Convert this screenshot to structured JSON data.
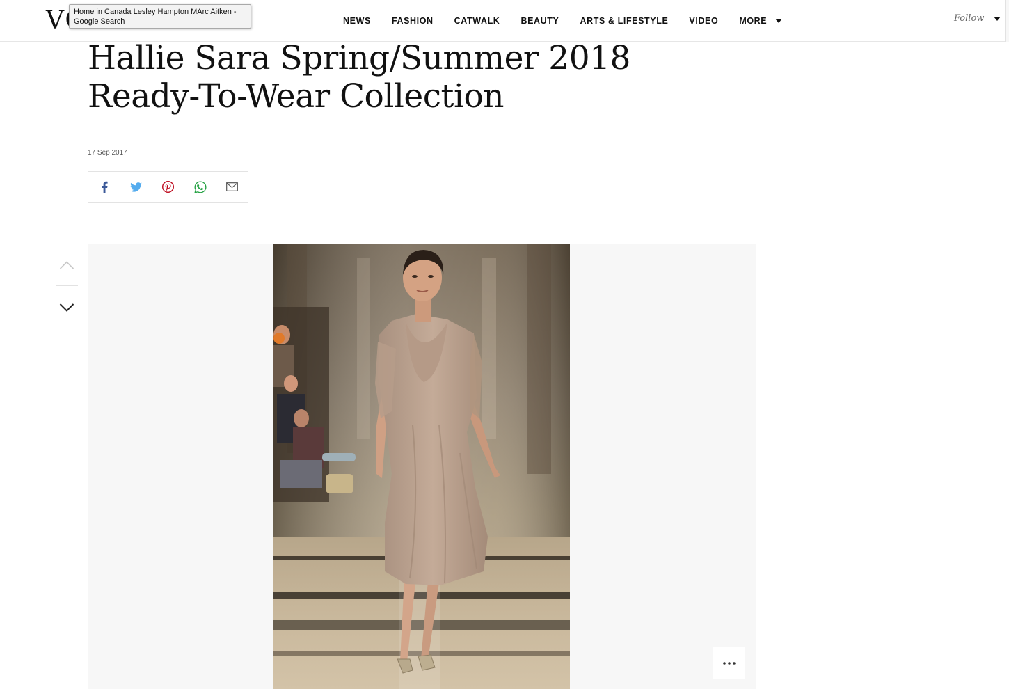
{
  "header": {
    "logo": "VOGUE",
    "tooltip": "Home in Canada Lesley Hampton MArc Aitken - Google Search",
    "nav": [
      "NEWS",
      "FASHION",
      "CATWALK",
      "BEAUTY",
      "ARTS & LIFESTYLE",
      "VIDEO"
    ],
    "more_label": "MORE",
    "follow_label": "Follow"
  },
  "article": {
    "title": "Hallie Sara Spring/Summer 2018 Ready-To-Wear Collection",
    "date": "17 Sep 2017"
  },
  "share": {
    "icons": [
      "facebook-icon",
      "twitter-icon",
      "pinterest-icon",
      "whatsapp-icon",
      "email-icon"
    ],
    "colors": {
      "facebook": "#3b5998",
      "twitter": "#55acee",
      "pinterest": "#bd081c",
      "whatsapp": "#25a244",
      "email": "#555555"
    }
  },
  "gallery": {
    "image": "runway-model-photo",
    "background": "#f7f7f7",
    "controls": [
      "chevron-up-icon",
      "chevron-down-icon",
      "more-options-icon"
    ]
  }
}
